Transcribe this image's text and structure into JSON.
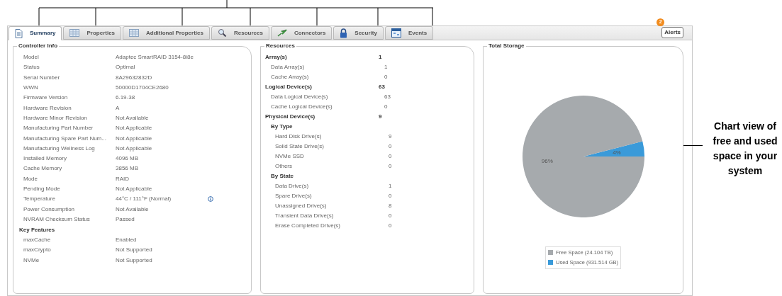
{
  "tabs": [
    {
      "label": "Summary",
      "selected": true
    },
    {
      "label": "Properties",
      "selected": false
    },
    {
      "label": "Additional Properties",
      "selected": false
    },
    {
      "label": "Resources",
      "selected": false
    },
    {
      "label": "Connectors",
      "selected": false
    },
    {
      "label": "Security",
      "selected": false
    },
    {
      "label": "Events",
      "selected": false
    }
  ],
  "alerts": {
    "label": "Alerts",
    "count": "2"
  },
  "controller_info": {
    "title": "Controller Info",
    "groups": [
      {
        "rows": [
          {
            "label": "Model",
            "value": "Adaptec SmartRAID 3154-8i8e",
            "kind": "plain"
          },
          {
            "label": "Status",
            "value": "Optimal",
            "kind": "plain"
          },
          {
            "label": "Serial Number",
            "value": "8A29632832D",
            "kind": "plain"
          },
          {
            "label": "WWN",
            "value": "50000D1704CE2680",
            "kind": "plain"
          },
          {
            "label": "Firmware Version",
            "value": "6.19-38",
            "kind": "plain"
          },
          {
            "label": "Hardware Revision",
            "value": "A",
            "kind": "plain"
          },
          {
            "label": "Hardware Minor Revision",
            "value": "Not Available",
            "kind": "plain"
          },
          {
            "label": "Manufacturing Part Number",
            "value": "Not Applicable",
            "kind": "plain"
          },
          {
            "label": "Manufacturing Spare Part Num...",
            "value": "Not Applicable",
            "kind": "plain"
          },
          {
            "label": "Manufacturing Wellness Log",
            "value": "Not Applicable",
            "kind": "plain"
          },
          {
            "label": "Installed Memory",
            "value": "4096 MB",
            "kind": "plain"
          },
          {
            "label": "Cache Memory",
            "value": "3856 MB",
            "kind": "plain"
          },
          {
            "label": "Mode",
            "value": "RAID",
            "kind": "plain"
          },
          {
            "label": "Pending Mode",
            "value": "Not Applicable",
            "kind": "plain"
          },
          {
            "label": "Temperature",
            "value": "44°C / 111°F (Normal)",
            "kind": "info"
          },
          {
            "label": "Power Consumption",
            "value": "Not Available",
            "kind": "plain"
          },
          {
            "label": "NVRAM Checksum Status",
            "value": "Passed",
            "kind": "plain"
          }
        ]
      },
      {
        "heading": "Key Features",
        "rows": [
          {
            "label": "maxCache",
            "value": "Enabled",
            "kind": "plain"
          },
          {
            "label": "maxCrypto",
            "value": "Not Supported",
            "kind": "plain"
          },
          {
            "label": "NVMe",
            "value": "Not Supported",
            "kind": "plain"
          }
        ]
      }
    ]
  },
  "resources": {
    "title": "Resources",
    "items": [
      {
        "label": "Array(s)",
        "value": "1",
        "children": [
          {
            "label": "Data Array(s)",
            "value": "1"
          },
          {
            "label": "Cache Array(s)",
            "value": "0"
          }
        ]
      },
      {
        "label": "Logical Device(s)",
        "value": "63",
        "children": [
          {
            "label": "Data Logical Device(s)",
            "value": "63"
          },
          {
            "label": "Cache Logical Device(s)",
            "value": "0"
          }
        ]
      },
      {
        "label": "Physical Device(s)",
        "value": "9",
        "children": [
          {
            "label": "By Type",
            "children": [
              {
                "label": "Hard Disk Drive(s)",
                "value": "9"
              },
              {
                "label": "Solid State Drive(s)",
                "value": "0"
              },
              {
                "label": "NVMe SSD",
                "value": "0"
              },
              {
                "label": "Others",
                "value": "0"
              }
            ]
          },
          {
            "label": "By State",
            "children": [
              {
                "label": "Data Drive(s)",
                "value": "1"
              },
              {
                "label": "Spare Drive(s)",
                "value": "0"
              },
              {
                "label": "Unassigned Drive(s)",
                "value": "8"
              },
              {
                "label": "Transient Data Drive(s)",
                "value": "0"
              },
              {
                "label": "Erase Completed Drive(s)",
                "value": "0"
              }
            ]
          }
        ]
      }
    ]
  },
  "total_storage": {
    "title": "Total Storage",
    "chart_data": {
      "type": "pie",
      "categories": [
        "Free Space (24.104 TB)",
        "Used Space (931.514 GB)"
      ],
      "values": [
        96,
        4
      ],
      "colors": [
        "#a6aaad",
        "#3a9ad9"
      ],
      "value_labels": [
        "96%",
        "4%"
      ]
    }
  },
  "annotation": {
    "text": "Chart view of free and used space in your system"
  }
}
